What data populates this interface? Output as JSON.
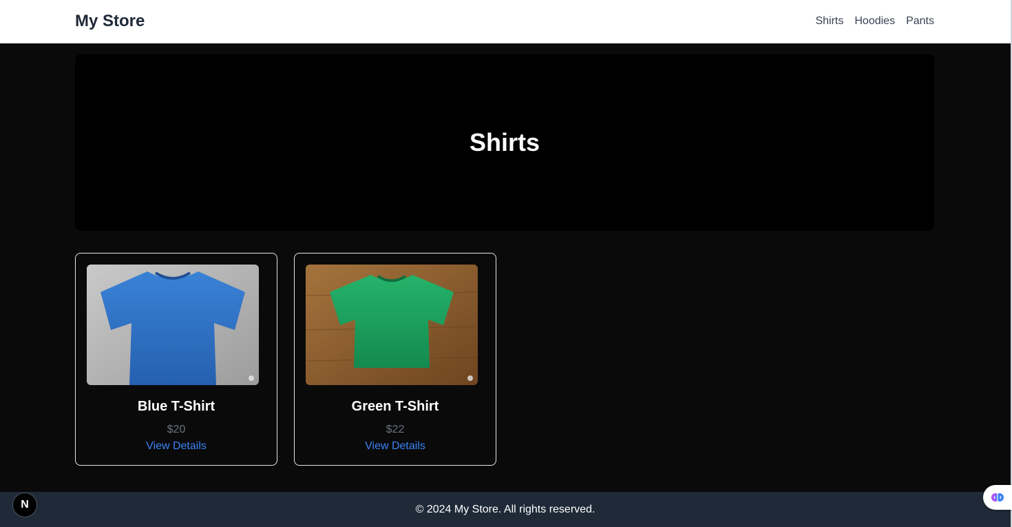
{
  "header": {
    "brand": "My Store",
    "nav": [
      {
        "label": "Shirts"
      },
      {
        "label": "Hoodies"
      },
      {
        "label": "Pants"
      }
    ]
  },
  "hero": {
    "title": "Shirts"
  },
  "products": [
    {
      "name": "Blue T-Shirt",
      "price": "$20",
      "link": "View Details",
      "color": "#2f73c9"
    },
    {
      "name": "Green T-Shirt",
      "price": "$22",
      "link": "View Details",
      "color": "#1fa35f"
    }
  ],
  "footer": {
    "text": "© 2024 My Store. All rights reserved."
  },
  "dev_badge": {
    "letter": "N"
  },
  "colors": {
    "page_bg": "#0a0a0a",
    "header_bg": "#ffffff",
    "hero_bg": "#000000",
    "link": "#3b82f6",
    "price": "#6b7280",
    "footer_bg": "#1f2937"
  }
}
